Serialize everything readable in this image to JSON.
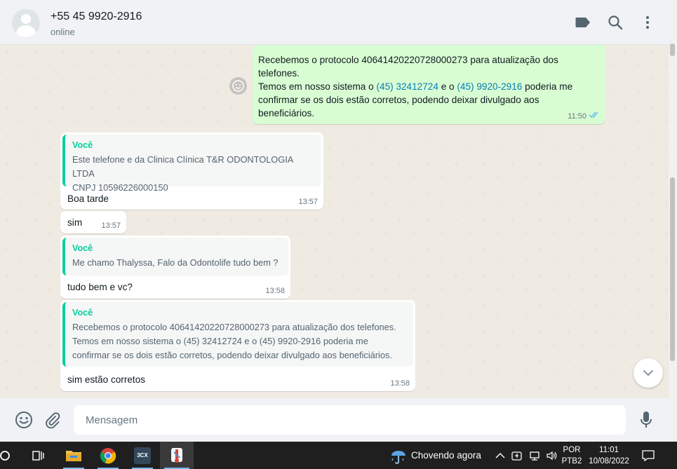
{
  "header": {
    "contact_name": "+55 45 9920-2916",
    "contact_status": "online",
    "icons": [
      "label-icon",
      "search-icon",
      "menu-icon"
    ]
  },
  "messages": [
    {
      "direction": "outgoing",
      "line1": "Recebemos o protocolo 40641420220728000273 para atualização dos",
      "line2": "telefones.",
      "line3_pre": "Temos em nosso sistema o ",
      "link1": "(45) 32412724",
      "line3_mid": " e o ",
      "link2": "(45) 9920-2916",
      "line3_post": " poderia me",
      "line4": "confirmar se os dois estão corretos, podendo deixar divulgado aos",
      "line5": "beneficiários.",
      "time": "11:50",
      "status": "read"
    },
    {
      "direction": "incoming",
      "quote_author": "Você",
      "quote_line1": "Este telefone e da Clinica Clínica T&R ODONTOLOGIA LTDA",
      "quote_line2": "CNPJ 10596226000150",
      "text": "Boa tarde",
      "time": "13:57"
    },
    {
      "direction": "incoming",
      "text": "sim",
      "time": "13:57"
    },
    {
      "direction": "incoming",
      "quote_author": "Você",
      "quote_line1": "Me chamo Thalyssa, Falo da Odontolife tudo bem ?",
      "text": "tudo bem e vc?",
      "time": "13:58"
    },
    {
      "direction": "incoming",
      "quote_author": "Você",
      "quote_line1": "Recebemos o protocolo 40641420220728000273 para atualização dos telefones.",
      "quote_line2": "Temos em nosso sistema o  (45) 32412724 e o (45) 9920-2916 poderia me",
      "quote_line3": "confirmar se os dois estão corretos, podendo deixar divulgado aos beneficiários.",
      "text": "sim estão corretos",
      "time": "13:58"
    }
  ],
  "footer": {
    "input_placeholder": "Mensagem",
    "icons": [
      "emoji-icon",
      "attach-icon",
      "microphone-icon"
    ]
  },
  "taskbar": {
    "weather": "Chovendo agora",
    "language_top": "POR",
    "language_bottom": "PTB2",
    "clock_time": "11:01",
    "clock_date": "10/08/2022",
    "app_3cx": "3CX"
  },
  "colors": {
    "outgoing_bubble": "#d9fdd3",
    "incoming_bubble": "#ffffff",
    "quote_accent": "#06cf9c",
    "link": "#027eb5",
    "chat_bg": "#efeae2"
  }
}
